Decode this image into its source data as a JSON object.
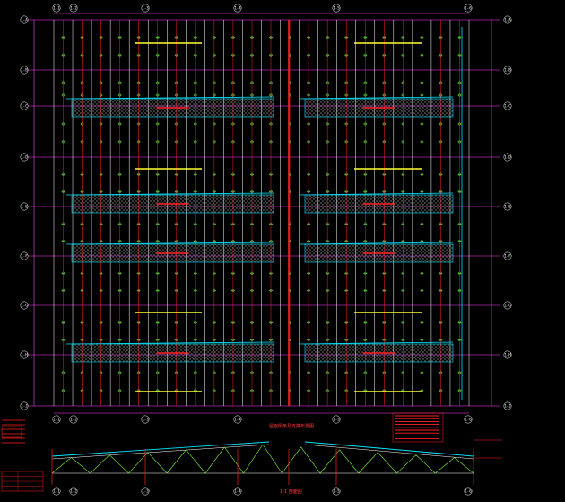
{
  "drawing": {
    "background": "#000000",
    "colors": {
      "grid_vertical": "#ffffff",
      "purlin_red": "#ff2020",
      "tie_green": "#7fff3f",
      "bracing_yellow": "#ffff33",
      "cyan": "#00e5ff",
      "magenta": "#ff40ff",
      "hatch_gray": "#9aa0a0"
    },
    "axis_labels_top": [
      "1-1",
      "1-2",
      "1-3",
      "1-4",
      "1-5",
      "1-6"
    ],
    "axis_labels_bottom": [
      "1-1",
      "1-2",
      "1-3",
      "1-4",
      "1-5",
      "1-6"
    ],
    "axis_labels_left": [
      "1-A",
      "1-B",
      "1-C",
      "1-D",
      "1-E",
      "1-F",
      "1-G",
      "1-H",
      "1-J"
    ],
    "axis_labels_right": [
      "1-A",
      "1-B",
      "1-C",
      "1-D",
      "1-E",
      "1-F",
      "1-G",
      "1-H",
      "1-J"
    ],
    "section_labels_bottom": [
      "1-1",
      "1-2",
      "1-3",
      "1-4",
      "1-5",
      "1-6"
    ],
    "plan_title": "屋面檩条及支撑布置图",
    "section_title": "1-1 剖面图"
  }
}
